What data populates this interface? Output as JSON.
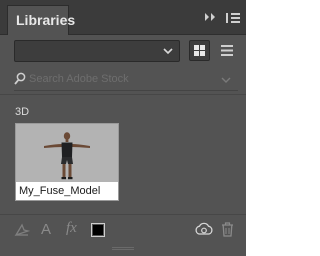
{
  "panel": {
    "tab_label": "Libraries"
  },
  "library_picker": {
    "selected": ""
  },
  "search": {
    "placeholder": "Search Adobe Stock"
  },
  "section": {
    "label": "3D"
  },
  "assets": [
    {
      "name": "My_Fuse_Model"
    }
  ],
  "footer": {
    "text_glyph": "A",
    "fx_glyph": "fx",
    "swatch_color": "#000000"
  },
  "colors": {
    "panel_bg": "#535353",
    "tabbar_bg": "#3b3b3b",
    "icon_light": "#e8e8e8",
    "icon_dim": "#8a8a8a"
  }
}
